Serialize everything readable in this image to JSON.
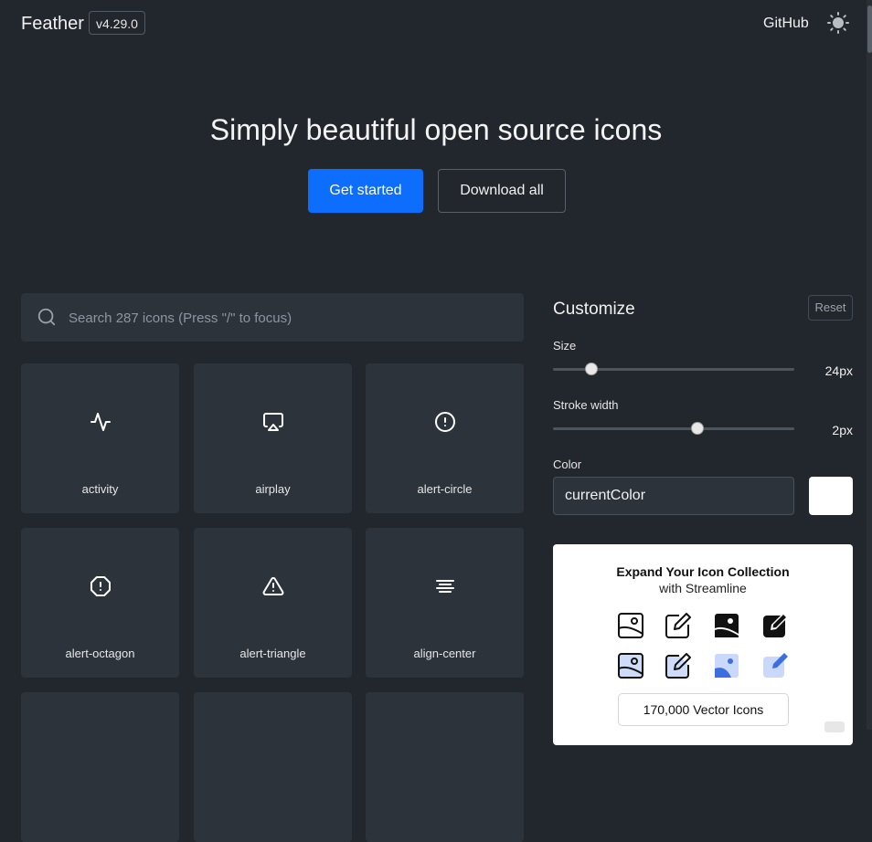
{
  "header": {
    "brand": "Feather",
    "version": "v4.29.0",
    "github_label": "GitHub",
    "theme_icon": "sun-icon"
  },
  "hero": {
    "title": "Simply beautiful open source icons",
    "primary_button": "Get started",
    "secondary_button": "Download all"
  },
  "search": {
    "placeholder": "Search 287 icons (Press \"/\" to focus)",
    "icon": "search-icon"
  },
  "icons": [
    {
      "name": "activity"
    },
    {
      "name": "airplay"
    },
    {
      "name": "alert-circle"
    },
    {
      "name": "alert-octagon"
    },
    {
      "name": "alert-triangle"
    },
    {
      "name": "align-center"
    }
  ],
  "customize": {
    "title": "Customize",
    "reset_label": "Reset",
    "size_label": "Size",
    "size_value": "24px",
    "size_level": 0.16,
    "stroke_label": "Stroke width",
    "stroke_value": "2px",
    "stroke_level": 0.6,
    "color_label": "Color",
    "color_value": "currentColor",
    "swatch_color": "#ffffff"
  },
  "ad": {
    "title": "Expand Your Icon Collection",
    "subtitle": "with Streamline",
    "button_label": "170,000 Vector Icons"
  },
  "colors": {
    "background": "#22272e",
    "card": "#2d333b",
    "accent": "#0d6efd",
    "ad_blue": "#3b6fe0"
  }
}
